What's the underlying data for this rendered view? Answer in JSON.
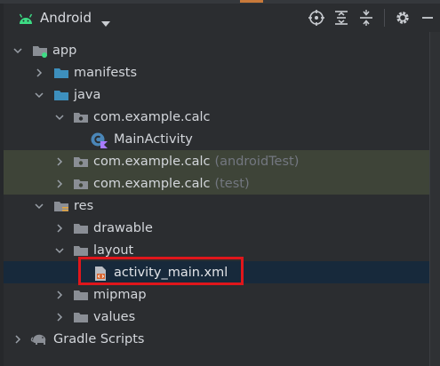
{
  "toolbar": {
    "view_label": "Android",
    "icons": [
      "android-icon",
      "chevron-down-icon",
      "locate-icon",
      "expand-all-icon",
      "collapse-all-icon",
      "gear-icon",
      "minimize-icon"
    ]
  },
  "tree": {
    "app": "app",
    "manifests": "manifests",
    "java": "java",
    "pkg_main": "com.example.calc",
    "main_activity": "MainActivity",
    "pkg_android_test": "com.example.calc",
    "pkg_android_test_suffix": "(androidTest)",
    "pkg_test": "com.example.calc",
    "pkg_test_suffix": "(test)",
    "res": "res",
    "drawable": "drawable",
    "layout": "layout",
    "activity_main": "activity_main.xml",
    "mipmap": "mipmap",
    "values": "values",
    "gradle_scripts": "Gradle Scripts"
  },
  "colors": {
    "background": "#2b2d30",
    "selection": "#17293b",
    "test_source_bg": "#3e4438",
    "highlight_border": "#e0161b",
    "folder_blue": "#3d8fbd",
    "android_green": "#3ddc84"
  }
}
